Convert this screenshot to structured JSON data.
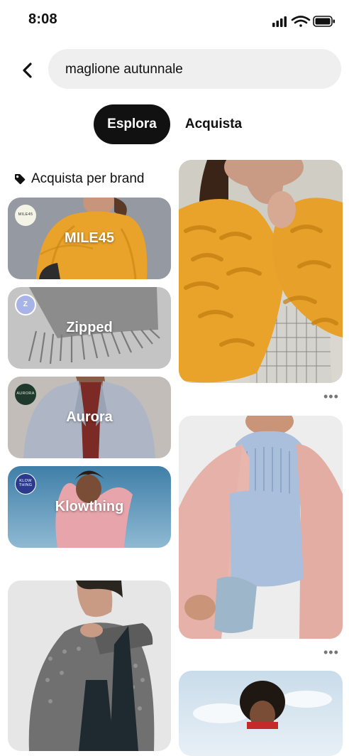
{
  "status": {
    "time": "8:08"
  },
  "search": {
    "value": "maglione autunnale"
  },
  "tabs": {
    "explore": "Esplora",
    "shop": "Acquista"
  },
  "brands": {
    "header": "Acquista per brand",
    "items": [
      {
        "name": "MILE45",
        "logo": "MILE45"
      },
      {
        "name": "Zipped",
        "logo": "Z"
      },
      {
        "name": "Aurora",
        "logo": "AURORA"
      },
      {
        "name": "Klowthing",
        "logo": "KLOW THING"
      }
    ]
  },
  "pins": {
    "more_symbol": "•••"
  },
  "colors": {
    "accent": "#111111",
    "search_bg": "#efefef",
    "mustard": "#e9a22a",
    "pink": "#e7a4aa",
    "baby_blue": "#a9bfdc"
  }
}
